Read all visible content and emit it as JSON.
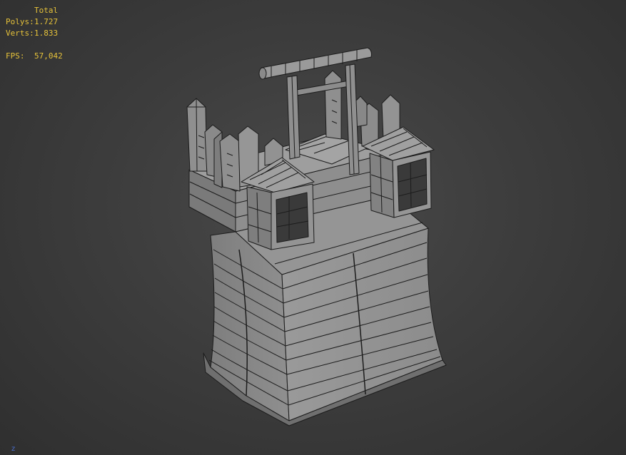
{
  "viewport_stats": {
    "header": "Total",
    "polys_label": "Polys:",
    "polys_value": "1.727",
    "verts_label": "Verts:",
    "verts_value": "1.833",
    "fps_label": "FPS:",
    "fps_value": "57,042"
  },
  "axis_indicator": "z",
  "colors": {
    "background": "#3b3b3b",
    "stats_text": "#e6c23a",
    "mesh_fill": "#8a8a8a",
    "wire": "#1c1c1c",
    "axis": "#4a6ed0"
  }
}
